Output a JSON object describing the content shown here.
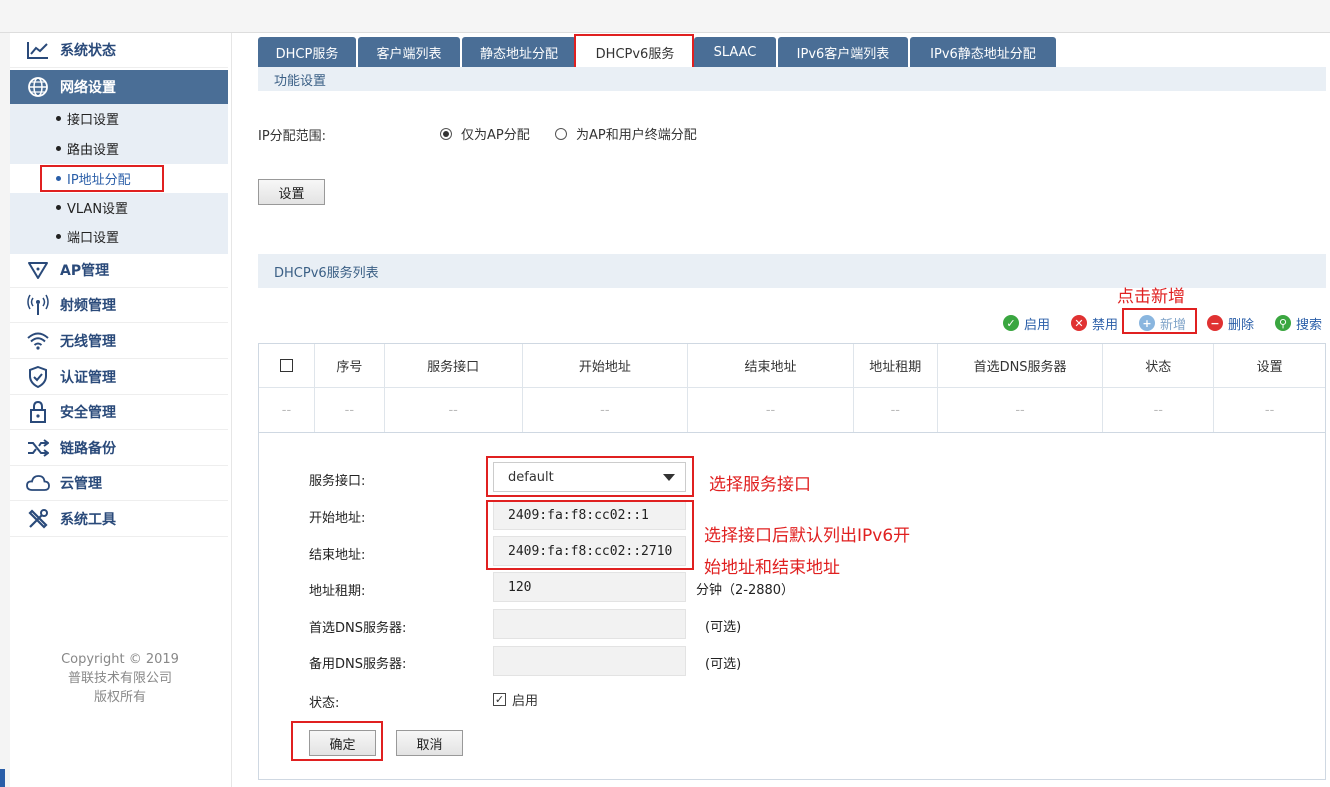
{
  "sidebar": {
    "menu": [
      {
        "label": "系统状态",
        "icon": "chart-line-icon"
      },
      {
        "label": "网络设置",
        "icon": "globe-icon"
      },
      {
        "label": "AP管理",
        "icon": "ap-icon"
      },
      {
        "label": "射频管理",
        "icon": "antenna-icon"
      },
      {
        "label": "无线管理",
        "icon": "wifi-icon"
      },
      {
        "label": "认证管理",
        "icon": "shield-icon"
      },
      {
        "label": "安全管理",
        "icon": "lock-icon"
      },
      {
        "label": "链路备份",
        "icon": "shuffle-icon"
      },
      {
        "label": "云管理",
        "icon": "cloud-icon"
      },
      {
        "label": "系统工具",
        "icon": "tools-icon"
      }
    ],
    "submenu": [
      "接口设置",
      "路由设置",
      "IP地址分配",
      "VLAN设置",
      "端口设置"
    ],
    "copyright": [
      "Copyright © 2019",
      "普联技术有限公司",
      "版权所有"
    ]
  },
  "tabs": [
    "DHCP服务",
    "客户端列表",
    "静态地址分配",
    "DHCPv6服务",
    "SLAAC",
    "IPv6客户端列表",
    "IPv6静态地址分配"
  ],
  "func": {
    "title": "功能设置",
    "range_label": "IP分配范围:",
    "opt1": "仅为AP分配",
    "opt2": "为AP和用户终端分配",
    "set_button": "设置"
  },
  "list": {
    "title": "DHCPv6服务列表",
    "tools": {
      "enable": "启用",
      "disable": "禁用",
      "add": "新增",
      "delete": "删除",
      "search": "搜索"
    },
    "columns": [
      "序号",
      "服务接口",
      "开始地址",
      "结束地址",
      "地址租期",
      "首选DNS服务器",
      "状态",
      "设置"
    ],
    "empty_row": [
      "--",
      "--",
      "--",
      "--",
      "--",
      "--",
      "--",
      "--",
      "--"
    ]
  },
  "form": {
    "iface_label": "服务接口:",
    "iface_value": "default",
    "start_label": "开始地址:",
    "start_value": "2409:fa:f8:cc02::1",
    "end_label": "结束地址:",
    "end_value": "2409:fa:f8:cc02::2710",
    "lease_label": "地址租期:",
    "lease_value": "120",
    "lease_unit": "分钟（2-2880）",
    "dns1_label": "首选DNS服务器:",
    "dns2_label": "备用DNS服务器:",
    "optional": "(可选)",
    "status_label": "状态:",
    "status_value": "启用",
    "ok": "确定",
    "cancel": "取消"
  },
  "annotations": {
    "click_add": "点击新增",
    "choose_iface": "选择服务接口",
    "default_line1": "选择接口后默认列出IPv6开",
    "default_line2": "始地址和结束地址"
  }
}
